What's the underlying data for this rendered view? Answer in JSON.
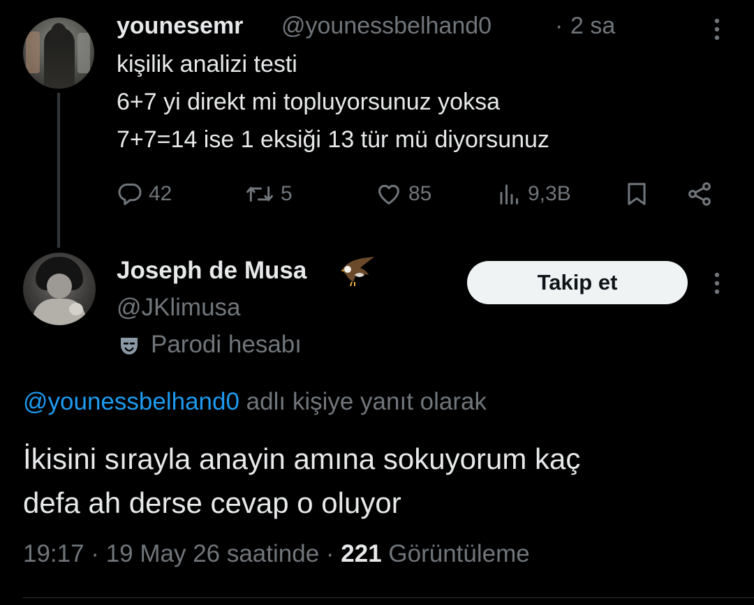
{
  "parent_tweet": {
    "display_name": "younesemr",
    "handle": "@younessbelhand0",
    "separator": "·",
    "time": "2 sa",
    "lines": [
      "kişilik analizi testi",
      "6+7 yi direkt mi topluyorsunuz yoksa",
      "7+7=14 ise 1 eksiği 13 tür mü diyorsunuz"
    ],
    "actions": {
      "replies": "42",
      "retweets": "5",
      "likes": "85",
      "views": "9,3B"
    }
  },
  "reply_tweet": {
    "display_name": "Joseph de Musa",
    "handle": "@JKlimusa",
    "parody_label": "Parodi hesabı",
    "follow_label": "Takip et",
    "reply_to_mention": "@younessbelhand0",
    "reply_to_suffix": " adlı kişiye yanıt olarak",
    "lines": [
      "İkisini sırayla anayin amına sokuyorum kaç",
      "defa ah derse cevap o oluyor"
    ],
    "meta": {
      "timestamp": "19:17 · 19 May 26 saatinde · ",
      "views_count": "221",
      "views_label": " Görüntüleme"
    }
  },
  "colors": {
    "background": "#000000",
    "text": "#e7e9ea",
    "muted": "#71767b",
    "link": "#1d9bf0",
    "button_bg": "#eff3f4"
  }
}
